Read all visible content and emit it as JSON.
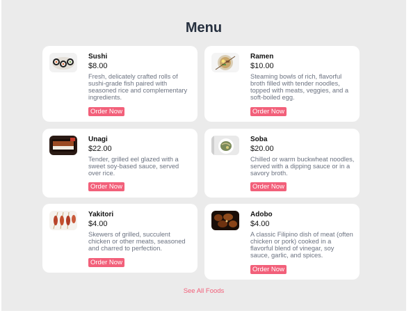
{
  "menu": {
    "title": "Menu",
    "order_label": "Order Now",
    "see_all_label": "See All Foods",
    "items": [
      {
        "name": "Sushi",
        "price": "$8.00",
        "description": "Fresh, delicately crafted rolls of sushi-grade fish paired with seasoned rice and complementary ingredients.",
        "icon": "sushi-photo"
      },
      {
        "name": "Ramen",
        "price": "$10.00",
        "description": "Steaming bowls of rich, flavorful broth filled with tender noodles, topped with meats, veggies, and a soft-boiled egg.",
        "icon": "ramen-photo"
      },
      {
        "name": "Unagi",
        "price": "$22.00",
        "description": "Tender, grilled eel glazed with a sweet soy-based sauce, served over rice.",
        "icon": "unagi-photo"
      },
      {
        "name": "Soba",
        "price": "$20.00",
        "description": "Chilled or warm buckwheat noodles, served with a dipping sauce or in a savory broth.",
        "icon": "soba-photo"
      },
      {
        "name": "Yakitori",
        "price": "$4.00",
        "description": "Skewers of grilled, succulent chicken or other meats, seasoned and charred to perfection.",
        "icon": "yakitori-photo"
      },
      {
        "name": "Adobo",
        "price": "$4.00",
        "description": "A classic Filipino dish of meat (often chicken or pork) cooked in a flavorful blend of vinegar, soy sauce, garlic, and spices.",
        "icon": "adobo-photo"
      }
    ]
  },
  "colors": {
    "accent": "#f2607a",
    "background": "#ebebeb",
    "card": "#ffffff",
    "title": "#26303f",
    "muted": "#6b7280"
  }
}
